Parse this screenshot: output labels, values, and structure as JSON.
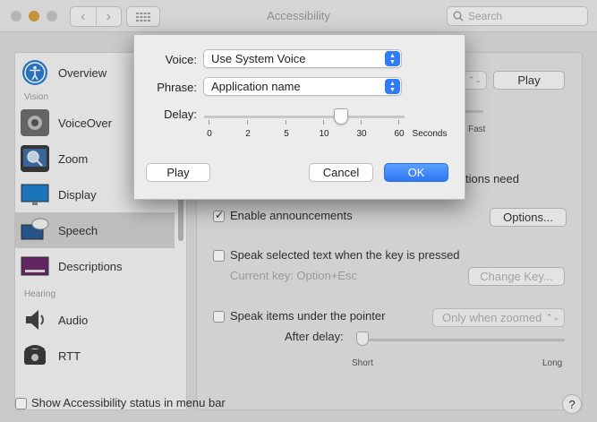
{
  "window": {
    "title": "Accessibility",
    "search_placeholder": "Search"
  },
  "sidebar": {
    "items": [
      {
        "label": "Overview",
        "icon": "accessibility-person-icon"
      },
      {
        "label": "VoiceOver",
        "icon": "voiceover-icon"
      },
      {
        "label": "Zoom",
        "icon": "zoom-icon"
      },
      {
        "label": "Display",
        "icon": "display-icon"
      },
      {
        "label": "Speech",
        "icon": "speech-bubble-icon"
      },
      {
        "label": "Descriptions",
        "icon": "descriptions-icon"
      },
      {
        "label": "Audio",
        "icon": "speaker-icon"
      },
      {
        "label": "RTT",
        "icon": "telephone-icon"
      }
    ],
    "sections": {
      "vision": "Vision",
      "hearing": "Hearing"
    }
  },
  "panel": {
    "play_button": "Play",
    "rate_fast": "Fast",
    "notify_text_partial": "tions need",
    "enable_announcements": "Enable announcements",
    "enable_announcements_checked": true,
    "options_button": "Options...",
    "speak_selected": "Speak selected text when the key is pressed",
    "current_key": "Current key: Option+Esc",
    "change_key_button": "Change Key...",
    "speak_items": "Speak items under the pointer",
    "only_when_zoomed": "Only when zoomed",
    "after_delay": "After delay:",
    "short": "Short",
    "long": "Long"
  },
  "bottom": {
    "show_status": "Show Accessibility status in menu bar",
    "help": "?"
  },
  "sheet": {
    "voice_label": "Voice:",
    "voice_value": "Use System Voice",
    "phrase_label": "Phrase:",
    "phrase_value": "Application name",
    "delay_label": "Delay:",
    "delay_ticks": [
      "0",
      "2",
      "5",
      "10",
      "30",
      "60"
    ],
    "delay_unit": "Seconds",
    "delay_selected": "20",
    "play_button": "Play",
    "cancel_button": "Cancel",
    "ok_button": "OK"
  },
  "colors": {
    "accent": "#2f7cf6",
    "sidebar_selected": "#cfcfcf"
  }
}
